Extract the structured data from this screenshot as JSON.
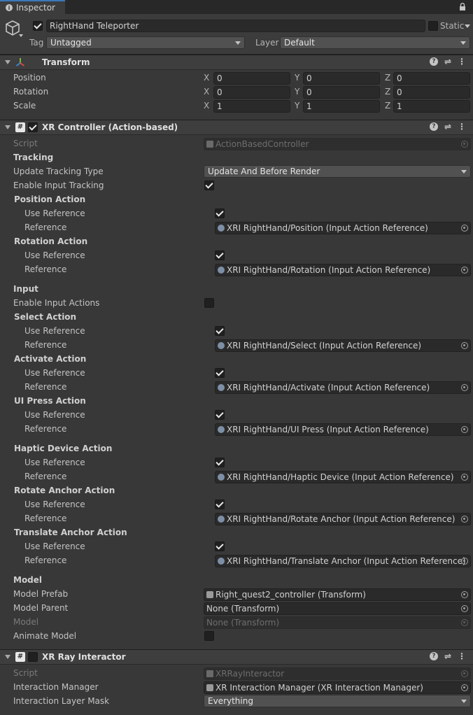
{
  "window": {
    "tab_label": "Inspector"
  },
  "header": {
    "active": true,
    "object_name": "RightHand Teleporter",
    "static_label": "Static",
    "tag_label": "Tag",
    "tag_value": "Untagged",
    "layer_label": "Layer",
    "layer_value": "Default"
  },
  "transform": {
    "title": "Transform",
    "axis": {
      "x": "X",
      "y": "Y",
      "z": "Z"
    },
    "rows": [
      {
        "label": "Position",
        "x": "0",
        "y": "0",
        "z": "0"
      },
      {
        "label": "Rotation",
        "x": "0",
        "y": "0",
        "z": "0"
      },
      {
        "label": "Scale",
        "x": "1",
        "y": "1",
        "z": "1"
      }
    ]
  },
  "xr_controller": {
    "title": "XR Controller (Action-based)",
    "enabled": true,
    "script_label": "Script",
    "script_value": "ActionBasedController",
    "tracking_header": "Tracking",
    "update_tracking_type_label": "Update Tracking Type",
    "update_tracking_type_value": "Update And Before Render",
    "enable_input_tracking_label": "Enable Input Tracking",
    "enable_input_tracking": true,
    "use_reference_label": "Use Reference",
    "reference_label": "Reference",
    "tracking_actions": [
      {
        "title": "Position Action",
        "use_reference": true,
        "reference": "XRI RightHand/Position (Input Action Reference)"
      },
      {
        "title": "Rotation Action",
        "use_reference": true,
        "reference": "XRI RightHand/Rotation (Input Action Reference)"
      }
    ],
    "input_header": "Input",
    "enable_input_actions_label": "Enable Input Actions",
    "enable_input_actions": false,
    "input_actions": [
      {
        "title": "Select Action",
        "use_reference": true,
        "reference": "XRI RightHand/Select (Input Action Reference)"
      },
      {
        "title": "Activate Action",
        "use_reference": true,
        "reference": "XRI RightHand/Activate (Input Action Reference)"
      },
      {
        "title": "UI Press Action",
        "use_reference": true,
        "reference": "XRI RightHand/UI Press (Input Action Reference)"
      },
      {
        "title": "Haptic Device Action",
        "use_reference": true,
        "reference": "XRI RightHand/Haptic Device (Input Action Reference)"
      },
      {
        "title": "Rotate Anchor Action",
        "use_reference": true,
        "reference": "XRI RightHand/Rotate Anchor (Input Action Reference)"
      },
      {
        "title": "Translate Anchor Action",
        "use_reference": true,
        "reference": "XRI RightHand/Translate Anchor (Input Action Reference)"
      }
    ],
    "model_header": "Model",
    "model_prefab_label": "Model Prefab",
    "model_prefab_value": "Right_quest2_controller (Transform)",
    "model_parent_label": "Model Parent",
    "model_parent_value": "None (Transform)",
    "model_label": "Model",
    "model_value": "None (Transform)",
    "animate_model_label": "Animate Model",
    "animate_model": false
  },
  "xr_ray_interactor": {
    "title": "XR Ray Interactor",
    "enabled": false,
    "script_label": "Script",
    "script_value": "XRRayInteractor",
    "interaction_manager_label": "Interaction Manager",
    "interaction_manager_value": "XR Interaction Manager (XR Interaction Manager)",
    "interaction_layer_mask_label": "Interaction Layer Mask",
    "interaction_layer_mask_value": "Everything"
  }
}
